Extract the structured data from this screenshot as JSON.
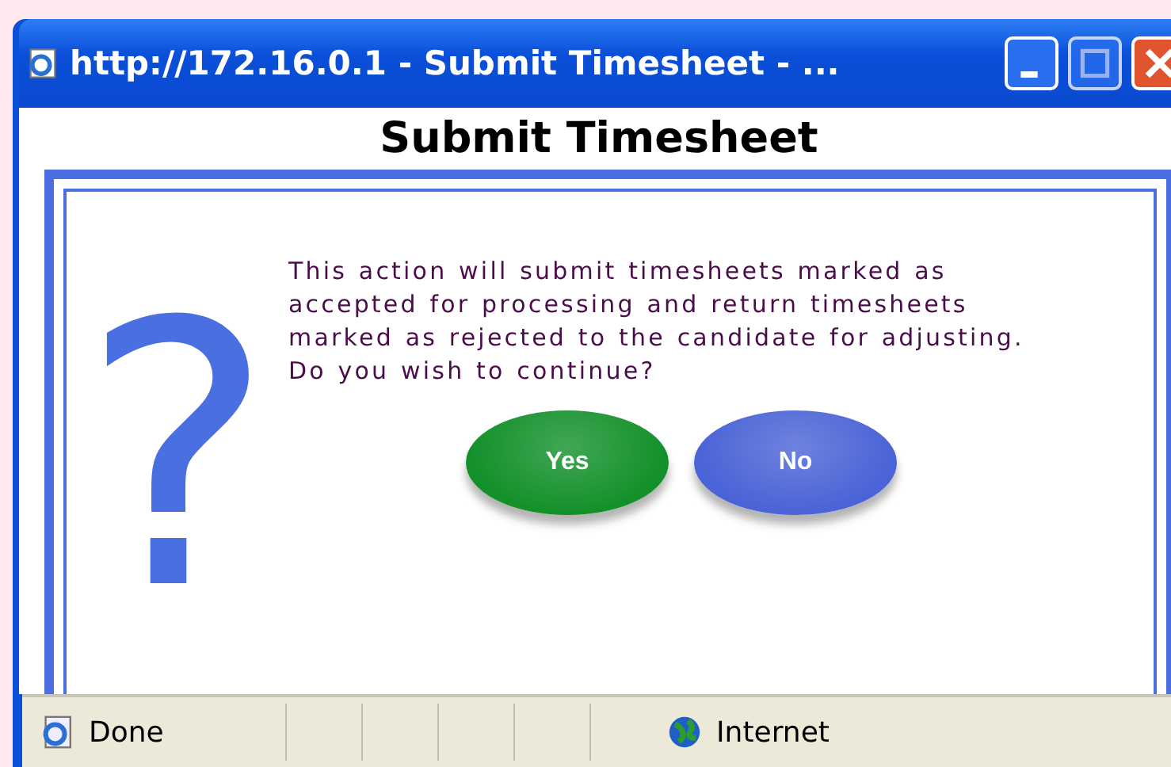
{
  "window": {
    "title": "http://172.16.0.1 - Submit Timesheet - ..."
  },
  "page": {
    "heading": "Submit Timesheet",
    "glyph": "?",
    "message": "This action will submit timesheets marked as accepted for processing and return timesheets marked as rejected to the candidate for adjusting. Do you wish to continue?"
  },
  "buttons": [
    {
      "label": "Yes",
      "color": "#13902a"
    },
    {
      "label": "No",
      "color": "#4a63d6"
    }
  ],
  "status_bar": {
    "status": "Done",
    "zone": "Internet"
  }
}
